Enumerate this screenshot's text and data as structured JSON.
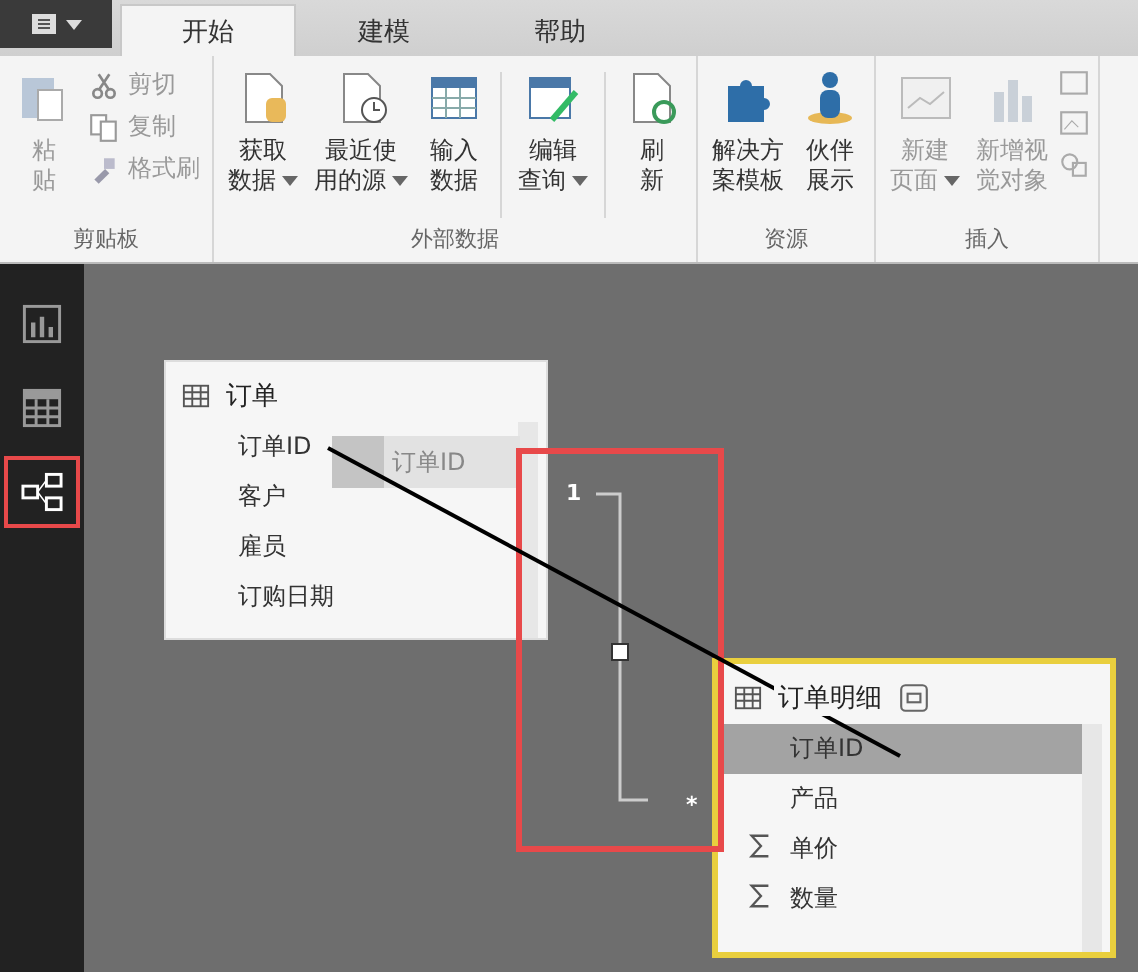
{
  "tabs": [
    {
      "label": "开始",
      "selected": true
    },
    {
      "label": "建模",
      "selected": false
    },
    {
      "label": "帮助",
      "selected": false
    }
  ],
  "ribbon_groups": [
    {
      "label": "剪贴板",
      "items": [
        {
          "kind": "large",
          "lines": [
            "粘",
            "贴"
          ],
          "dropdown": false,
          "disabled": true
        },
        {
          "kind": "small",
          "lines": [
            "剪切"
          ],
          "disabled": true
        },
        {
          "kind": "small",
          "lines": [
            "复制"
          ],
          "disabled": true
        },
        {
          "kind": "small",
          "lines": [
            "格式刷"
          ],
          "disabled": true
        }
      ]
    },
    {
      "label": "外部数据",
      "items": [
        {
          "kind": "large",
          "lines": [
            "获取",
            "数据"
          ],
          "dropdown": true,
          "disabled": false
        },
        {
          "kind": "large",
          "lines": [
            "最近使",
            "用的源"
          ],
          "dropdown": true,
          "disabled": false
        },
        {
          "kind": "large",
          "lines": [
            "输入",
            "数据"
          ],
          "dropdown": false,
          "disabled": false
        },
        {
          "kind": "separator"
        },
        {
          "kind": "large",
          "lines": [
            "编辑",
            "查询"
          ],
          "dropdown": true,
          "disabled": false
        },
        {
          "kind": "separator"
        },
        {
          "kind": "large",
          "lines": [
            "刷",
            "新"
          ],
          "dropdown": false,
          "disabled": false
        }
      ]
    },
    {
      "label": "资源",
      "items": [
        {
          "kind": "large",
          "lines": [
            "解决方",
            "案模板"
          ],
          "dropdown": false,
          "disabled": false
        },
        {
          "kind": "large",
          "lines": [
            "伙伴",
            "展示"
          ],
          "dropdown": false,
          "disabled": false
        }
      ]
    },
    {
      "label": "插入",
      "items": [
        {
          "kind": "large",
          "lines": [
            "新建",
            "页面"
          ],
          "dropdown": true,
          "disabled": true
        },
        {
          "kind": "large",
          "lines": [
            "新增视",
            "觉对象"
          ],
          "dropdown": false,
          "disabled": true
        },
        {
          "kind": "stack"
        }
      ]
    }
  ],
  "view_nav": [
    {
      "selected": false
    },
    {
      "selected": false
    },
    {
      "selected": true
    }
  ],
  "tables": [
    {
      "name": "订单",
      "highlighted": false,
      "fields": [
        {
          "kind": "text",
          "name": "订单ID",
          "selected": false
        },
        {
          "kind": "text",
          "name": "客户",
          "selected": false
        },
        {
          "kind": "text",
          "name": "雇员",
          "selected": false
        },
        {
          "kind": "text",
          "name": "订购日期",
          "selected": false
        }
      ]
    },
    {
      "name": "订单明细",
      "highlighted": true,
      "fields": [
        {
          "kind": "text",
          "name": "订单ID",
          "selected": true
        },
        {
          "kind": "text",
          "name": "产品",
          "selected": false
        },
        {
          "kind": "sum",
          "name": "单价",
          "selected": false
        },
        {
          "kind": "sum",
          "name": "数量",
          "selected": false
        }
      ]
    }
  ],
  "drag_ghost": {
    "label": "订单ID"
  },
  "relationship": {
    "from_cardinality": "1",
    "to_cardinality": "*"
  }
}
